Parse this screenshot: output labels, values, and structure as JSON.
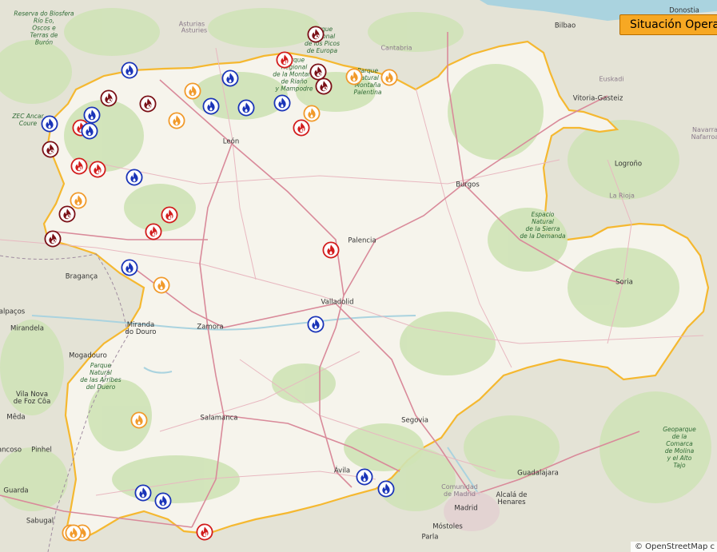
{
  "map": {
    "status_button_label": "Situación Opera",
    "attribution": "© OpenStreetMap c",
    "colors": {
      "land": "#e9e6df",
      "region_fill": "#f6f4ec",
      "region_border": "#f5b830",
      "forest": "#cfe3b6",
      "water": "#aad3df",
      "road": "#e39aa6",
      "motorway": "#d86a82",
      "fire_active": "#d21c1c",
      "fire_stabilized": "#7a0f16",
      "fire_controlled": "#f19a2b",
      "fire_extinguished": "#1a34b8"
    },
    "places": [
      {
        "name": "Reserva do Biosfera\nRío Eo,\nOscos e\nTerras de\nBurón",
        "kind": "park"
      },
      {
        "name": "Asturias",
        "kind": "region"
      },
      {
        "name": "Asturies",
        "kind": "region"
      },
      {
        "name": "Cantabria",
        "kind": "region"
      },
      {
        "name": "Bilbao",
        "kind": "city"
      },
      {
        "name": "Donostia",
        "kind": "city"
      },
      {
        "name": "Euskadi",
        "kind": "region"
      },
      {
        "name": "Vitoria-Gasteiz",
        "kind": "city"
      },
      {
        "name": "Navarra\nNafarroa",
        "kind": "region"
      },
      {
        "name": "Logroño",
        "kind": "city"
      },
      {
        "name": "La Rioja",
        "kind": "region"
      },
      {
        "name": "León",
        "kind": "city"
      },
      {
        "name": "Burgos",
        "kind": "city"
      },
      {
        "name": "Palencia",
        "kind": "city"
      },
      {
        "name": "Valladolid",
        "kind": "city"
      },
      {
        "name": "Soria",
        "kind": "city"
      },
      {
        "name": "Zamora",
        "kind": "city"
      },
      {
        "name": "Salamanca",
        "kind": "city"
      },
      {
        "name": "Segovia",
        "kind": "city"
      },
      {
        "name": "Ávila",
        "kind": "city"
      },
      {
        "name": "Madrid",
        "kind": "city"
      },
      {
        "name": "Comunidad\nde Madrid",
        "kind": "region"
      },
      {
        "name": "Guadalajara",
        "kind": "city"
      },
      {
        "name": "Alcalá de\nHenares",
        "kind": "city"
      },
      {
        "name": "Móstoles",
        "kind": "city"
      },
      {
        "name": "Parla",
        "kind": "city"
      },
      {
        "name": "Bragança",
        "kind": "city"
      },
      {
        "name": "Miranda\ndo Douro",
        "kind": "city"
      },
      {
        "name": "Mogadouro",
        "kind": "city"
      },
      {
        "name": "Mirandela",
        "kind": "city"
      },
      {
        "name": "Vila Nova\nde Foz Côa",
        "kind": "city"
      },
      {
        "name": "Mêda",
        "kind": "city"
      },
      {
        "name": "Pinhel",
        "kind": "city"
      },
      {
        "name": "Guarda",
        "kind": "city"
      },
      {
        "name": "Sabugal",
        "kind": "city"
      },
      {
        "name": "ancoso",
        "kind": "city"
      },
      {
        "name": "alpaços",
        "kind": "city"
      },
      {
        "name": "ZEC Ancar\nCoure",
        "kind": "park"
      },
      {
        "name": "Parque\nNatural\nde las Arribes\ndel Duero",
        "kind": "park"
      },
      {
        "name": "Espacio\nNatural\nde la Sierra\nde la Demanda",
        "kind": "park"
      },
      {
        "name": "Parque\nNatural\nMontaña\nPalentina",
        "kind": "park"
      },
      {
        "name": "Geoparque\nde la Comarca\nde Molina\ny el Alto\nTajo",
        "kind": "park"
      },
      {
        "name": "Parque\nRegional\nde la Montaña\nde Riaño\ny Mampodre",
        "kind": "park"
      },
      {
        "name": "Parque\nNacional\nde los Picos\nde Europa",
        "kind": "park"
      }
    ],
    "fire_markers": [
      {
        "status": "stabilized",
        "level": "2"
      },
      {
        "status": "active",
        "level": "1"
      },
      {
        "status": "stabilized",
        "level": "2"
      },
      {
        "status": "stabilized",
        "level": "2"
      },
      {
        "status": "controlled",
        "level": ""
      },
      {
        "status": "controlled",
        "level": ""
      },
      {
        "status": "extinguished",
        "level": ""
      },
      {
        "status": "controlled",
        "level": ""
      },
      {
        "status": "extinguished",
        "level": ""
      },
      {
        "status": "stabilized",
        "level": "2"
      },
      {
        "status": "stabilized",
        "level": "2"
      },
      {
        "status": "extinguished",
        "level": ""
      },
      {
        "status": "extinguished",
        "level": ""
      },
      {
        "status": "extinguished",
        "level": ""
      },
      {
        "status": "controlled",
        "level": ""
      },
      {
        "status": "extinguished",
        "level": ""
      },
      {
        "status": "active",
        "level": "1"
      },
      {
        "status": "extinguished",
        "level": ""
      },
      {
        "status": "active",
        "level": "1"
      },
      {
        "status": "extinguished",
        "level": ""
      },
      {
        "status": "controlled",
        "level": ""
      },
      {
        "status": "active",
        "level": "1"
      },
      {
        "status": "stabilized",
        "level": "2"
      },
      {
        "status": "active",
        "level": "1"
      },
      {
        "status": "stabilized",
        "level": "2"
      },
      {
        "status": "extinguished",
        "level": ""
      },
      {
        "status": "controlled",
        "level": ""
      },
      {
        "status": "active",
        "level": "1"
      },
      {
        "status": "active",
        "level": "1"
      },
      {
        "status": "stabilized",
        "level": "2"
      },
      {
        "status": "active",
        "level": ""
      },
      {
        "status": "controlled",
        "level": ""
      },
      {
        "status": "extinguished",
        "level": ""
      },
      {
        "status": "controlled",
        "level": ""
      },
      {
        "status": "extinguished",
        "level": ""
      },
      {
        "status": "controlled",
        "level": ""
      },
      {
        "status": "extinguished",
        "level": ""
      },
      {
        "status": "extinguished",
        "level": ""
      },
      {
        "status": "extinguished",
        "level": ""
      },
      {
        "status": "extinguished",
        "level": ""
      },
      {
        "status": "controlled",
        "level": ""
      },
      {
        "status": "controlled",
        "level": ""
      },
      {
        "status": "active",
        "level": "1"
      }
    ]
  }
}
